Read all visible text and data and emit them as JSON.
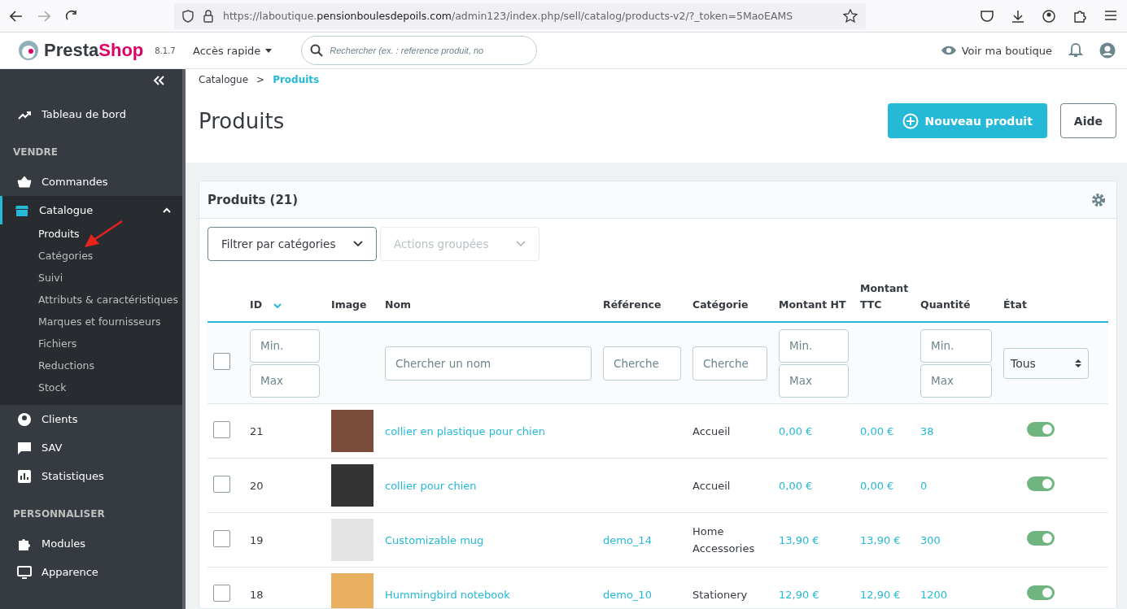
{
  "browser": {
    "url": {
      "prefix": "https://laboutique.",
      "domain": "pensionboulesdepoils.com",
      "path": "/admin123/index.php/sell/catalog/products-v2/?_token=5MaoEAMS"
    }
  },
  "header": {
    "logo": {
      "name_a": "Presta",
      "name_b": "Shop",
      "version": "8.1.7"
    },
    "quick_access": "Accès rapide",
    "search": {
      "placeholder": "Rechercher (ex. : reference produit, no"
    },
    "view_shop": "Voir ma boutique"
  },
  "sidebar": {
    "items": [
      {
        "kind": "item",
        "label": "Tableau de bord",
        "selected": false
      },
      {
        "kind": "section",
        "label": "VENDRE"
      },
      {
        "kind": "item",
        "label": "Commandes",
        "selected": false
      },
      {
        "kind": "item",
        "label": "Catalogue",
        "selected": true,
        "expanded": true,
        "children": [
          {
            "label": "Produits",
            "selected": true
          },
          {
            "label": "Catégories",
            "selected": false
          },
          {
            "label": "Suivi",
            "selected": false
          },
          {
            "label": "Attributs & caractéristiques",
            "selected": false
          },
          {
            "label": "Marques et fournisseurs",
            "selected": false
          },
          {
            "label": "Fichiers",
            "selected": false
          },
          {
            "label": "Reductions",
            "selected": false
          },
          {
            "label": "Stock",
            "selected": false
          }
        ]
      },
      {
        "kind": "item",
        "label": "Clients",
        "selected": false
      },
      {
        "kind": "item",
        "label": "SAV",
        "selected": false
      },
      {
        "kind": "item",
        "label": "Statistiques",
        "selected": false
      },
      {
        "kind": "section",
        "label": "PERSONNALISER"
      },
      {
        "kind": "item",
        "label": "Modules",
        "selected": false
      },
      {
        "kind": "item",
        "label": "Apparence",
        "selected": false
      }
    ]
  },
  "breadcrumb": {
    "items": [
      "Catalogue",
      "Produits"
    ],
    "separator": ">"
  },
  "title": "Produits",
  "buttons": {
    "new": "Nouveau produit",
    "help": "Aide"
  },
  "card": {
    "title": "Produits (21)",
    "filter_categories": "Filtrer par catégories",
    "bulk_actions": "Actions groupées"
  },
  "table": {
    "columns": [
      "ID",
      "Image",
      "Nom",
      "Référence",
      "Catégorie",
      "Montant HT",
      "Montant TTC",
      "Quantité",
      "État"
    ],
    "select_all_checked": false,
    "filters": {
      "id_min": {
        "placeholder": "Min."
      },
      "id_max": {
        "placeholder": "Max"
      },
      "name": {
        "placeholder": "Chercher un nom"
      },
      "reference": {
        "placeholder": "Cherche"
      },
      "category": {
        "placeholder": "Cherche"
      },
      "ht_min": {
        "placeholder": "Min."
      },
      "ht_max": {
        "placeholder": "Max"
      },
      "qty_min": {
        "placeholder": "Min."
      },
      "qty_max": {
        "placeholder": "Max"
      },
      "state": "Tous"
    },
    "rows": [
      {
        "id": "21",
        "name": "collier en plastique pour chien",
        "reference": "",
        "category": "Accueil",
        "price_ht": "0,00 €",
        "price_ttc": "0,00 €",
        "quantity": "38",
        "active": true,
        "checked": false
      },
      {
        "id": "20",
        "name": "collier pour chien",
        "reference": "",
        "category": "Accueil",
        "price_ht": "0,00 €",
        "price_ttc": "0,00 €",
        "quantity": "0",
        "active": true,
        "checked": false
      },
      {
        "id": "19",
        "name": "Customizable mug",
        "reference": "demo_14",
        "category": "Home Accessories",
        "price_ht": "13,90 €",
        "price_ttc": "13,90 €",
        "quantity": "300",
        "active": true,
        "checked": false
      },
      {
        "id": "18",
        "name": "Hummingbird notebook",
        "reference": "demo_10",
        "category": "Stationery",
        "price_ht": "12,90 €",
        "price_ttc": "12,90 €",
        "quantity": "1200",
        "active": true,
        "checked": false
      }
    ]
  }
}
